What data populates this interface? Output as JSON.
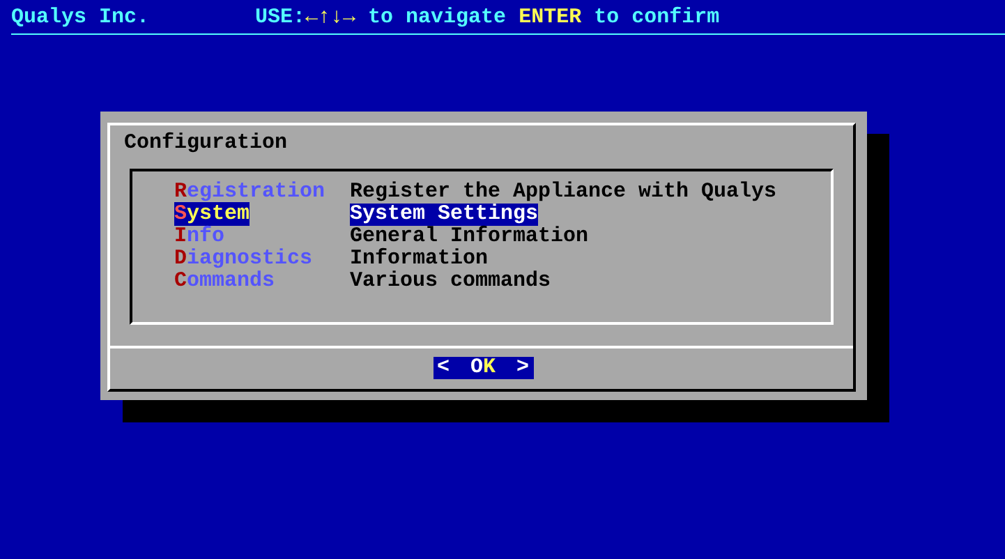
{
  "header": {
    "brand": "Qualys Inc.",
    "hint": [
      {
        "text": "USE:",
        "highlight": false
      },
      {
        "text": "←↑↓→",
        "highlight": true
      },
      {
        "text": " to navigate ",
        "highlight": false
      },
      {
        "text": "ENTER",
        "highlight": true
      },
      {
        "text": " to confirm",
        "highlight": false
      }
    ]
  },
  "dialog": {
    "title": "Configuration",
    "items": [
      {
        "label": "Registration",
        "description": "Register the Appliance with Qualys",
        "selected": false
      },
      {
        "label": "System",
        "description": "System Settings",
        "selected": true
      },
      {
        "label": "Info",
        "description": "General Information",
        "selected": false
      },
      {
        "label": "Diagnostics",
        "description": "Information",
        "selected": false
      },
      {
        "label": "Commands",
        "description": "Various commands",
        "selected": false
      }
    ],
    "button": {
      "left": "<",
      "label": [
        {
          "text": "O",
          "highlight": false
        },
        {
          "text": "K",
          "highlight": true
        }
      ],
      "right": ">"
    }
  }
}
